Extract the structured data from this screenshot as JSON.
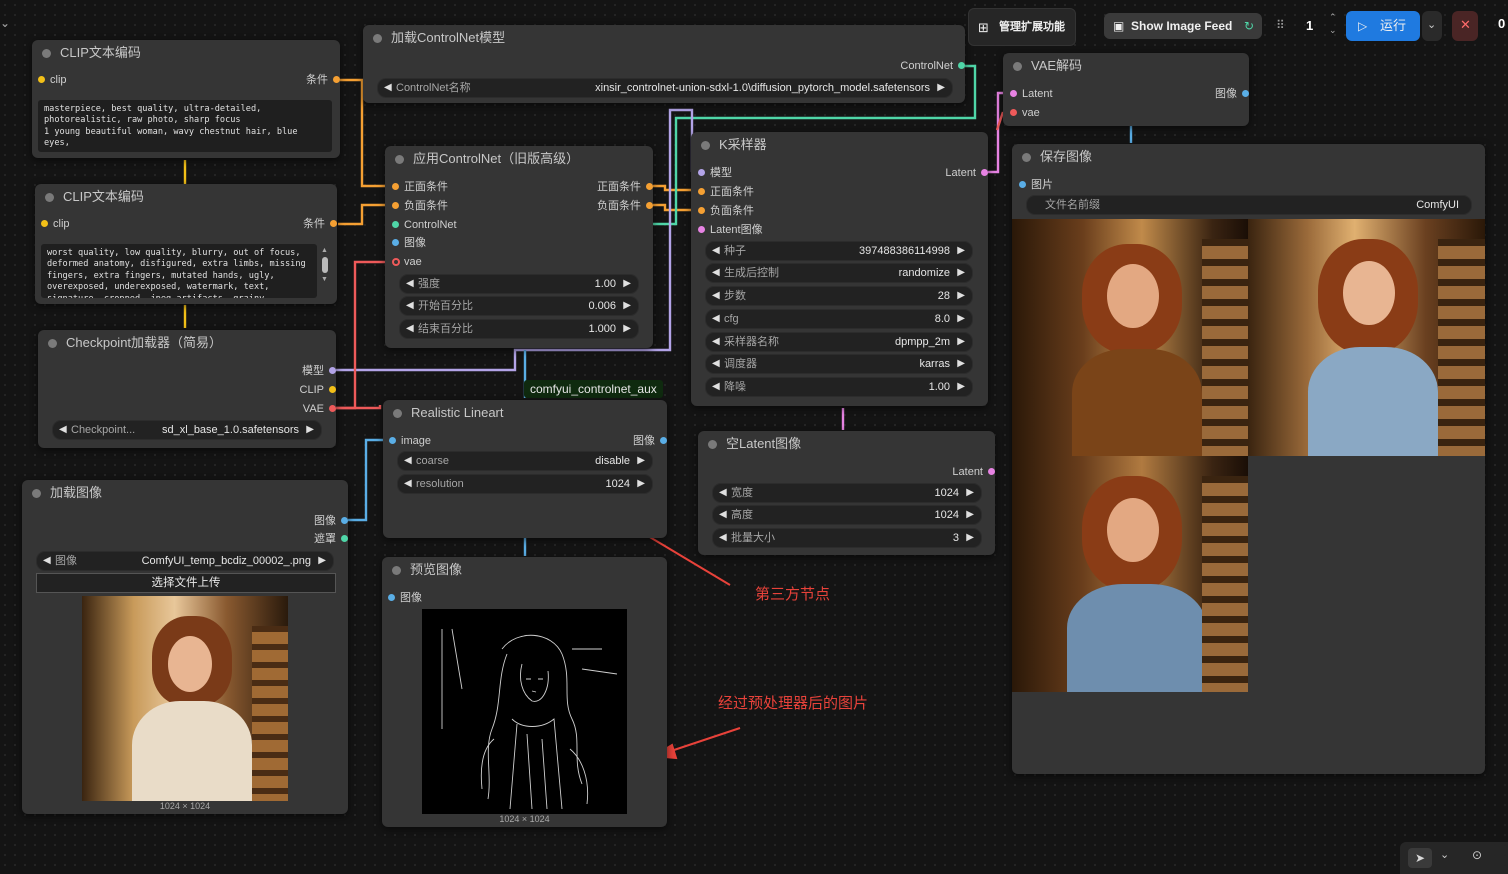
{
  "toolbar": {
    "manage_extensions": "管理扩展功能",
    "show_image_feed": "Show Image Feed",
    "batch_count": "1",
    "run_label": "运行",
    "queue_count": "0"
  },
  "nodes": {
    "clip_text_positive": {
      "title": "CLIP文本编码",
      "input_clip": "clip",
      "output_label": "条件",
      "text": "masterpiece, best quality, ultra-detailed, photorealistic, raw photo, sharp focus\n1 young beautiful woman, wavy chestnut hair, blue eyes,"
    },
    "clip_text_negative": {
      "title": "CLIP文本编码",
      "input_clip": "clip",
      "output_label": "条件",
      "text": "worst quality, low quality, blurry, out of focus, deformed anatomy, disfigured, extra limbs, missing fingers, extra fingers, mutated hands, ugly, overexposed, underexposed, watermark, text, signature, cropped, jpeg artifacts, grainy"
    },
    "checkpoint_loader": {
      "title": "Checkpoint加载器（简易）",
      "outputs": [
        "模型",
        "CLIP",
        "VAE"
      ],
      "widget_label": "Checkpoint...",
      "widget_value": "sd_xl_base_1.0.safetensors"
    },
    "load_image": {
      "title": "加载图像",
      "outputs": [
        "图像",
        "遮罩"
      ],
      "widget_label": "图像",
      "widget_value": "ComfyUI_temp_bcdiz_00002_.png",
      "upload_button": "选择文件上传",
      "size_caption": "1024 × 1024"
    },
    "controlnet_loader": {
      "title": "加载ControlNet模型",
      "output": "ControlNet",
      "widget_label": "ControlNet名称",
      "widget_value": "xinsir_controlnet-union-sdxl-1.0\\diffusion_pytorch_model.safetensors"
    },
    "apply_controlnet": {
      "title": "应用ControlNet（旧版高级）",
      "inputs": [
        "正面条件",
        "负面条件",
        "ControlNet",
        "图像",
        "vae"
      ],
      "outputs": [
        "正面条件",
        "负面条件"
      ],
      "widgets": [
        {
          "label": "强度",
          "value": "1.00"
        },
        {
          "label": "开始百分比",
          "value": "0.006"
        },
        {
          "label": "结束百分比",
          "value": "1.000"
        }
      ]
    },
    "group_tag": "comfyui_controlnet_aux",
    "realistic_lineart": {
      "title": "Realistic Lineart",
      "input": "image",
      "output": "图像",
      "widgets": [
        {
          "label": "coarse",
          "value": "disable"
        },
        {
          "label": "resolution",
          "value": "1024"
        }
      ]
    },
    "preview_image": {
      "title": "预览图像",
      "input": "图像",
      "size_caption": "1024 × 1024"
    },
    "ksampler": {
      "title": "K采样器",
      "inputs": [
        "模型",
        "正面条件",
        "负面条件",
        "Latent图像"
      ],
      "output": "Latent",
      "widgets": [
        {
          "label": "种子",
          "value": "397488386114998"
        },
        {
          "label": "生成后控制",
          "value": "randomize"
        },
        {
          "label": "步数",
          "value": "28"
        },
        {
          "label": "cfg",
          "value": "8.0"
        },
        {
          "label": "采样器名称",
          "value": "dpmpp_2m"
        },
        {
          "label": "调度器",
          "value": "karras"
        },
        {
          "label": "降噪",
          "value": "1.00"
        }
      ]
    },
    "empty_latent": {
      "title": "空Latent图像",
      "output": "Latent",
      "widgets": [
        {
          "label": "宽度",
          "value": "1024"
        },
        {
          "label": "高度",
          "value": "1024"
        },
        {
          "label": "批量大小",
          "value": "3"
        }
      ]
    },
    "vae_decode": {
      "title": "VAE解码",
      "inputs": [
        "Latent",
        "vae"
      ],
      "output": "图像"
    },
    "save_image": {
      "title": "保存图像",
      "input": "图片",
      "widget_label": "文件名前缀",
      "widget_value": "ComfyUI"
    }
  },
  "annotations": {
    "third_party_node": "第三方节点",
    "preprocessed_image": "经过预处理器后的图片"
  },
  "colors": {
    "canvas": "#141414",
    "node_bg": "#353535",
    "clip_yellow": "#f3c018",
    "conditioning_orange": "#f5a033",
    "controlnet_teal": "#4fd6a8",
    "image_blue": "#5aaee6",
    "vae_red": "#ee5a5a",
    "latent_pink": "#e783e3",
    "model_lavender": "#b3a4e8",
    "run_blue": "#1f7ae0",
    "annotation_red": "#e8423a"
  }
}
